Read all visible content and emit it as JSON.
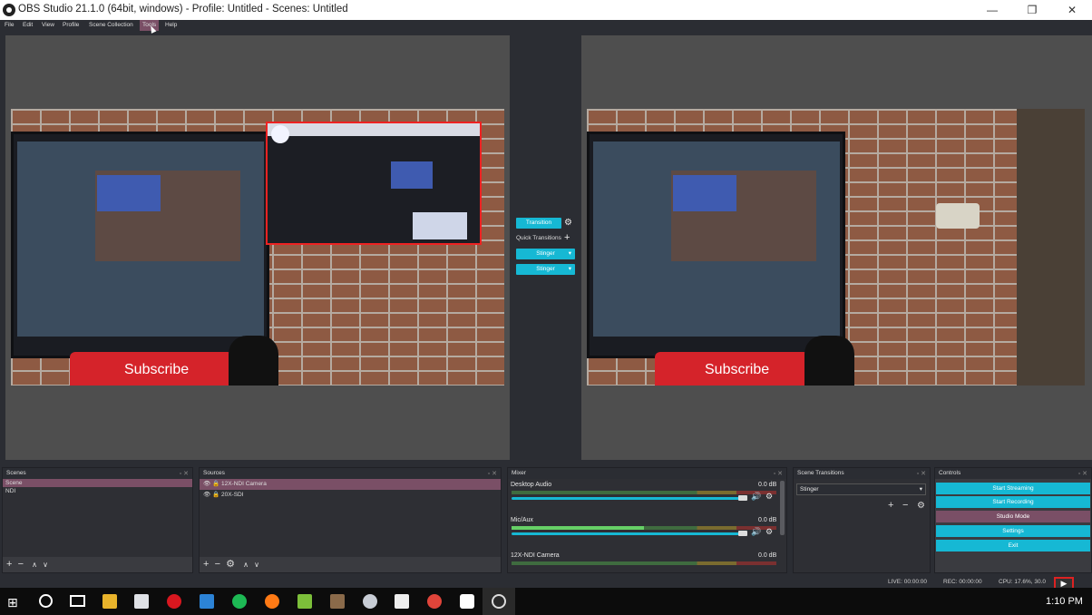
{
  "window": {
    "title": "OBS Studio 21.1.0 (64bit, windows) - Profile: Untitled - Scenes: Untitled",
    "min": "—",
    "max": "❐",
    "close": "✕"
  },
  "menu": [
    "File",
    "Edit",
    "View",
    "Profile",
    "Scene Collection",
    "Tools",
    "Help"
  ],
  "transitions": {
    "transition_label": "Transition",
    "quick_label": "Quick Transitions",
    "stinger1": "Stinger",
    "stinger2": "Stinger"
  },
  "preview": {
    "pillow_text": "Subscribe"
  },
  "program": {
    "pillow_text": "Subscribe"
  },
  "scenes": {
    "title": "Scenes",
    "items": [
      "Scene",
      "NDI"
    ],
    "selected": 0
  },
  "sources": {
    "title": "Sources",
    "items": [
      "12X-NDI Camera",
      "20X-SDI"
    ],
    "selected": 0
  },
  "mixer": {
    "title": "Mixer",
    "channels": [
      {
        "name": "Desktop Audio",
        "db": "0.0 dB"
      },
      {
        "name": "Mic/Aux",
        "db": "0.0 dB"
      },
      {
        "name": "12X-NDI Camera",
        "db": "0.0 dB"
      }
    ]
  },
  "scene_transitions": {
    "title": "Scene Transitions",
    "selected": "Stinger"
  },
  "controls": {
    "title": "Controls",
    "buttons": [
      "Start Streaming",
      "Start Recording",
      "Studio Mode",
      "Settings",
      "Exit"
    ]
  },
  "status": {
    "live": "LIVE: 00:00:00",
    "rec": "REC: 00:00:00",
    "cpu": "CPU: 17.6%, 30.0"
  },
  "taskbar": {
    "time": "1:10 PM"
  }
}
